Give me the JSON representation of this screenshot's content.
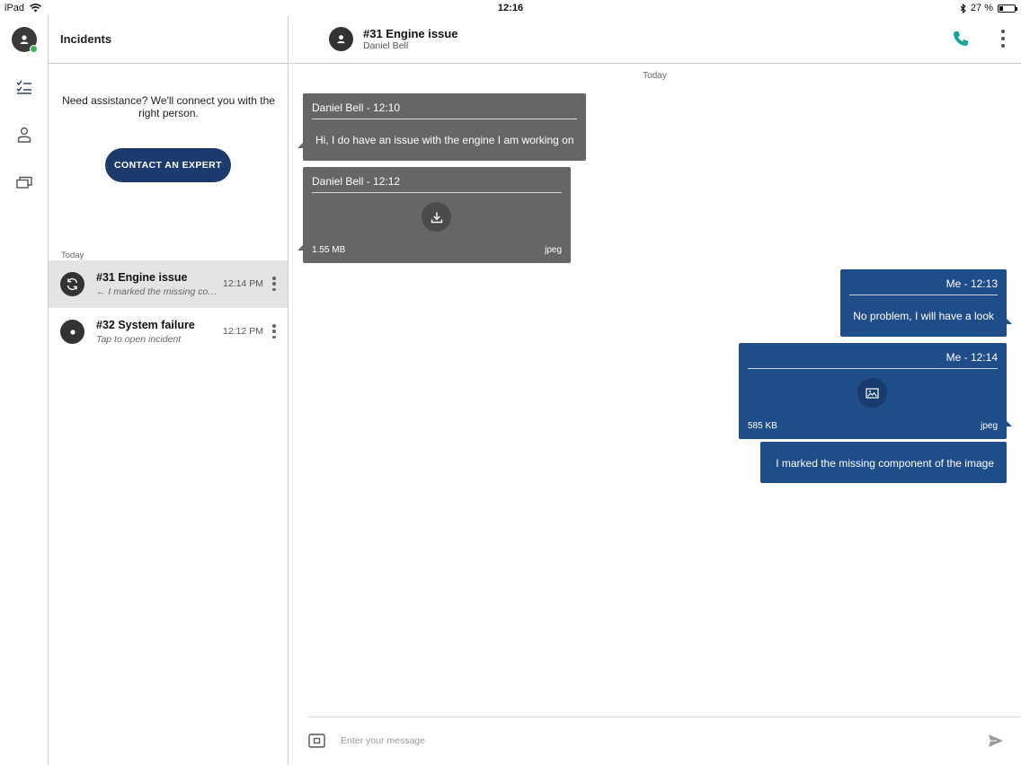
{
  "status_bar": {
    "device": "iPad",
    "time": "12:16",
    "battery": "27 %",
    "battery_level": 0.27
  },
  "rail": {
    "items": [
      {
        "name": "incidents-list-icon"
      },
      {
        "name": "contacts-icon"
      },
      {
        "name": "windows-icon"
      }
    ],
    "user_status": "online"
  },
  "incidents_panel": {
    "title": "Incidents",
    "assist_text": "Need assistance? We'll connect you with the right person.",
    "contact_button": "CONTACT AN EXPERT",
    "section_label": "Today",
    "items": [
      {
        "title": "#31 Engine issue",
        "subtitle": "← I marked the missing component of the image",
        "time": "12:14 PM",
        "icon": "sync-icon",
        "active": true
      },
      {
        "title": "#32 System failure",
        "subtitle": "Tap to open incident",
        "time": "12:12 PM",
        "icon": "record-icon",
        "active": false
      }
    ]
  },
  "chat": {
    "title": "#31 Engine issue",
    "subtitle": "Daniel Bell",
    "day_label": "Today",
    "accent_color": "#1aa59a",
    "messages": [
      {
        "direction": "in",
        "header": "Daniel Bell - 12:10",
        "text": "Hi, I do have an issue with the engine I am working on"
      },
      {
        "direction": "in",
        "header": "Daniel Bell - 12:12",
        "file_size": "1.55 MB",
        "file_type": "jpeg",
        "icon": "download-icon"
      },
      {
        "direction": "out",
        "header": "Me - 12:13",
        "text": "No problem, I will have a look"
      },
      {
        "direction": "out",
        "header": "Me - 12:14",
        "file_size": "585 KB",
        "file_type": "jpeg",
        "icon": "image-icon"
      },
      {
        "direction": "out",
        "text": "I marked the missing component of the image"
      }
    ],
    "composer": {
      "placeholder": "Enter your message",
      "value": ""
    }
  }
}
